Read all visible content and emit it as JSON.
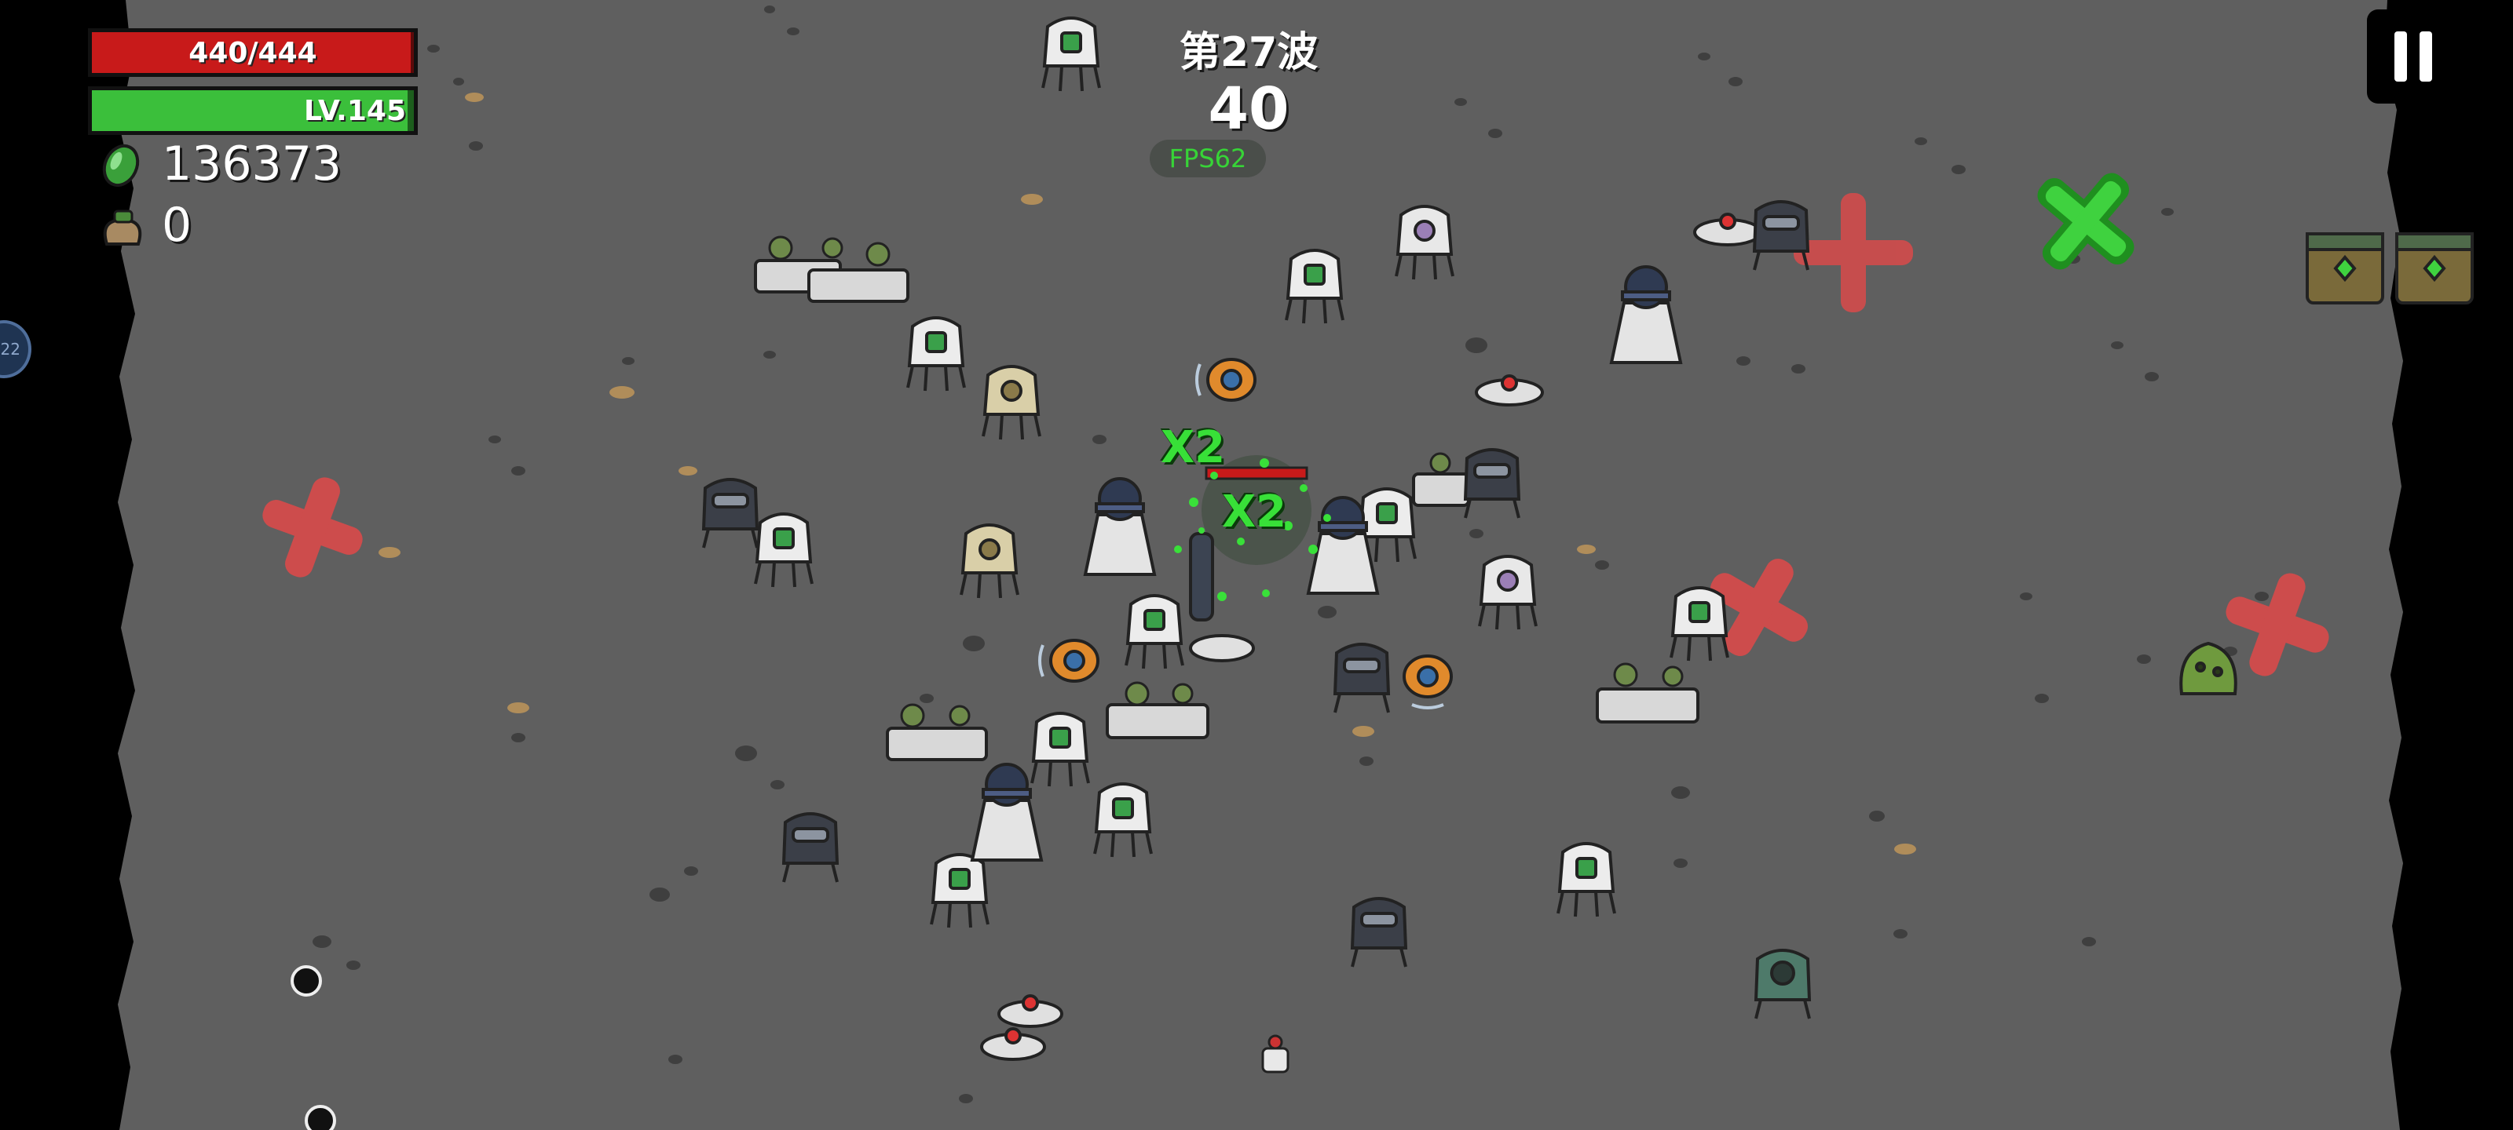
{
  "hud": {
    "hp": {
      "text": "440/444",
      "current": 440,
      "max": 444,
      "color": "#c81a1a"
    },
    "level": {
      "text": "LV.145",
      "progress": 0.98,
      "color": "#3bbf3b"
    },
    "coins": {
      "value": "136373",
      "icon": "green-gem-icon"
    },
    "bag": {
      "value": "0",
      "icon": "loot-bag-icon"
    },
    "wave": "第27波",
    "timer": "40",
    "fps": "FPS62",
    "side_badge": "22",
    "pause_icon": "pause-icon"
  },
  "combat_text": {
    "multiplier_1": "X2",
    "multiplier_2": "X2"
  },
  "arena": {
    "background_color": "#5f5f5f",
    "edge_color": "#000000",
    "x_marker_colors": [
      "#d94a4a",
      "#3fd23f"
    ]
  }
}
